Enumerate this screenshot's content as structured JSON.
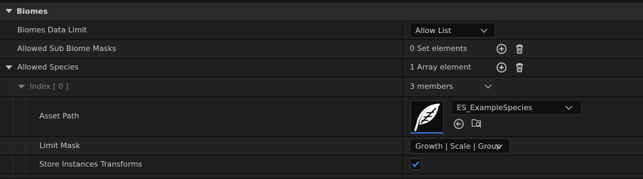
{
  "category": {
    "title": "Biomes"
  },
  "rows": {
    "biomes_data_limit": {
      "label": "Biomes Data Limit",
      "value": "Allow List"
    },
    "allowed_sub_biome_masks": {
      "label": "Allowed Sub Biome Masks",
      "value": "0 Set elements"
    },
    "allowed_species": {
      "label": "Allowed Species",
      "value": "1 Array element"
    },
    "index0": {
      "label": "Index [ 0 ]",
      "value": "3 members"
    },
    "asset_path": {
      "label": "Asset Path",
      "value": "ES_ExampleSpecies"
    },
    "limit_mask": {
      "label": "Limit Mask",
      "value": "Growth | Scale | Group"
    },
    "store_instances_transforms": {
      "label": "Store Instances Transforms",
      "checked": true
    }
  },
  "icons": {
    "add": "plus-circle-icon",
    "remove": "trash-icon",
    "browse_back": "arrow-left-circle-icon",
    "browse_folder": "folder-search-icon",
    "thumbnail": "feather-icon"
  },
  "colors": {
    "accent": "#2f6fd6",
    "background": "#1a1a1a",
    "category": "#2a2a2a"
  }
}
